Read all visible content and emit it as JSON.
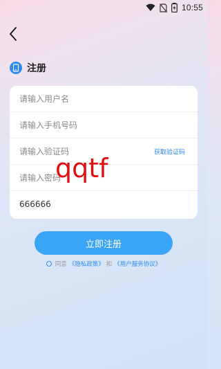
{
  "status_bar": {
    "time": "10:55",
    "icons": [
      "wifi-icon",
      "sim-off-icon",
      "battery-charging-icon"
    ]
  },
  "header": {
    "back_icon": "chevron-left-icon"
  },
  "page": {
    "title": "注册",
    "title_icon": "phone-icon"
  },
  "form": {
    "username": {
      "placeholder": "请输入用户名",
      "value": ""
    },
    "phone": {
      "placeholder": "请输入手机号码",
      "value": ""
    },
    "code": {
      "placeholder": "请输入验证码",
      "value": "",
      "get_code_label": "获取验证码"
    },
    "password": {
      "placeholder": "请输入密码",
      "value": ""
    },
    "confirm": {
      "placeholder": "",
      "value": "666666"
    }
  },
  "overlay_text": "qqtf",
  "register_button": {
    "label": "立即注册"
  },
  "agreement": {
    "prefix": "同意",
    "privacy_link": "《隐私政策》",
    "and": "和",
    "service_link": "《用户服务协议》"
  },
  "colors": {
    "accent": "#3aa4f5",
    "link": "#2f8df0",
    "overlay": "#e01010"
  }
}
